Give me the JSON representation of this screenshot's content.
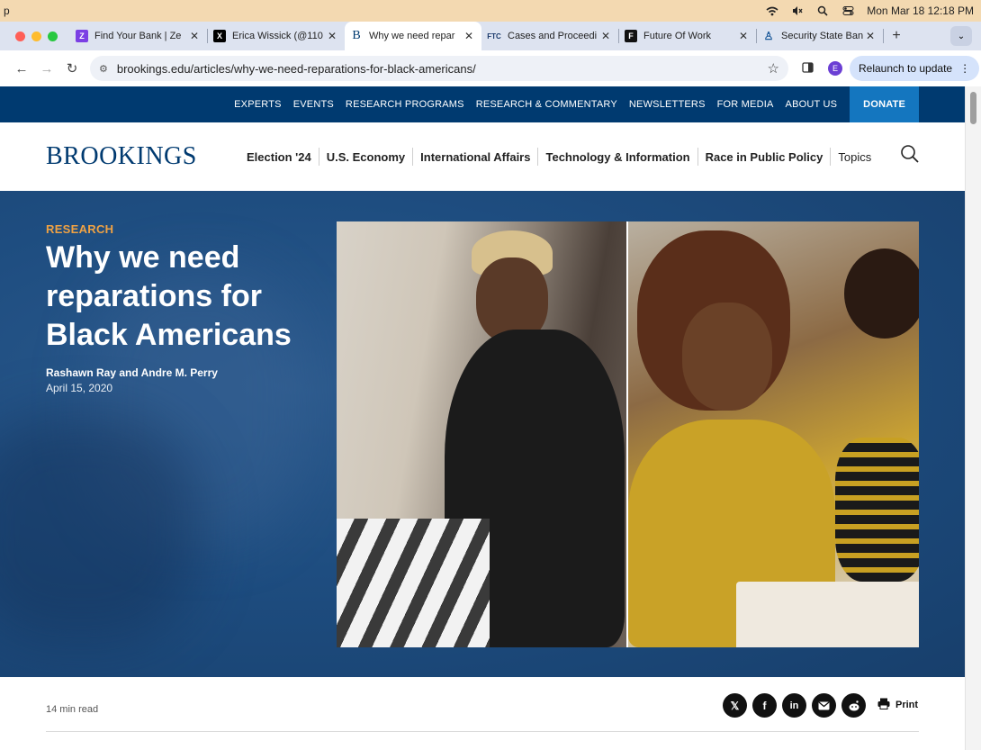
{
  "menubar": {
    "app_letter": "p",
    "datetime": "Mon Mar 18  12:18 PM"
  },
  "tabs": [
    {
      "title": "Find Your Bank | Ze",
      "icon_text": "Z",
      "icon_color": "#7b3fe4"
    },
    {
      "title": "Erica Wissick (@110",
      "icon_text": "X",
      "icon_color": "#000000"
    },
    {
      "title": "Why we need repar",
      "icon_text": "B",
      "icon_color": "#ffffff"
    },
    {
      "title": "Cases and Proceedi",
      "icon_text": "FTC",
      "icon_color": "#ffffff"
    },
    {
      "title": "Future Of Work",
      "icon_text": "F",
      "icon_color": "#000000"
    },
    {
      "title": "Security State Bank",
      "icon_text": "♙",
      "icon_color": "#ffffff"
    }
  ],
  "toolbar": {
    "url": "brookings.edu/articles/why-we-need-reparations-for-black-americans/",
    "profile_initial": "E",
    "relaunch_label": "Relaunch to update"
  },
  "utility_nav": [
    "EXPERTS",
    "EVENTS",
    "RESEARCH PROGRAMS",
    "RESEARCH & COMMENTARY",
    "NEWSLETTERS",
    "FOR MEDIA",
    "ABOUT US"
  ],
  "donate_label": "DONATE",
  "logo": "BROOKINGS",
  "main_nav": [
    "Election '24",
    "U.S. Economy",
    "International Affairs",
    "Technology & Information",
    "Race in Public Policy",
    "Topics"
  ],
  "hero": {
    "label": "RESEARCH",
    "title": "Why we need reparations for Black Americans",
    "authors": "Rashawn Ray and Andre M. Perry",
    "date": "April 15, 2020"
  },
  "article_meta": {
    "read_time": "14 min read",
    "print_label": "Print"
  },
  "share_icons": [
    "x-icon",
    "facebook-icon",
    "linkedin-icon",
    "email-icon",
    "reddit-icon"
  ],
  "colors": {
    "brand_navy": "#003a70",
    "donate_blue": "#1476bf",
    "research_orange": "#f0a243"
  }
}
